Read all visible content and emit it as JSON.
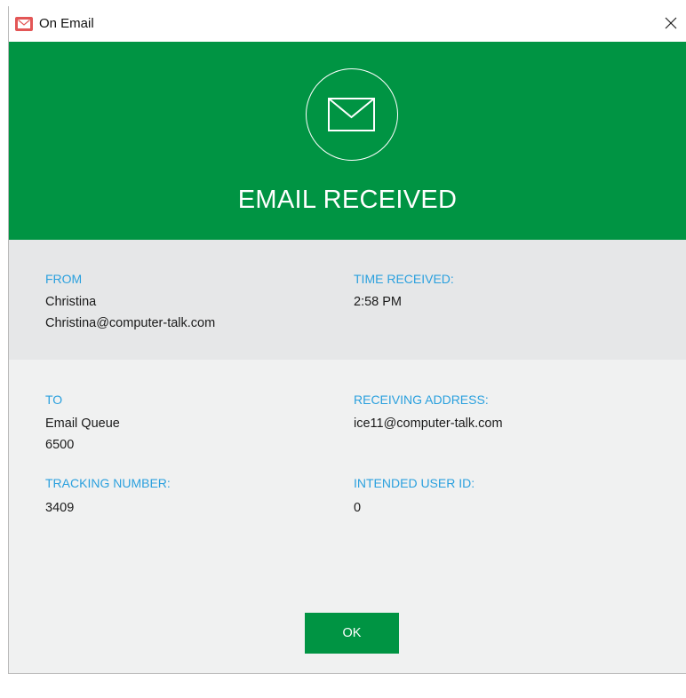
{
  "window": {
    "title": "On Email",
    "close_glyph": "✕",
    "app_icon": "mail-icon"
  },
  "banner": {
    "icon": "envelope-icon",
    "title": "EMAIL RECEIVED",
    "color": "#009443"
  },
  "from": {
    "label": "FROM",
    "name": "Christina",
    "email": "Christina@computer-talk.com"
  },
  "time_received": {
    "label": "TIME RECEIVED:",
    "value": "2:58 PM"
  },
  "to": {
    "label": "TO",
    "queue": "Email Queue",
    "number": "6500"
  },
  "receiving_address": {
    "label": "RECEIVING ADDRESS:",
    "value": "ice11@computer-talk.com"
  },
  "tracking_number": {
    "label": "TRACKING NUMBER:",
    "value": "3409"
  },
  "intended_user_id": {
    "label": "INTENDED USER ID:",
    "value": "0"
  },
  "ok_button": {
    "label": "OK"
  },
  "colors": {
    "accent_green": "#009443",
    "label_blue": "#2aa0de",
    "icon_red": "#e35656"
  }
}
